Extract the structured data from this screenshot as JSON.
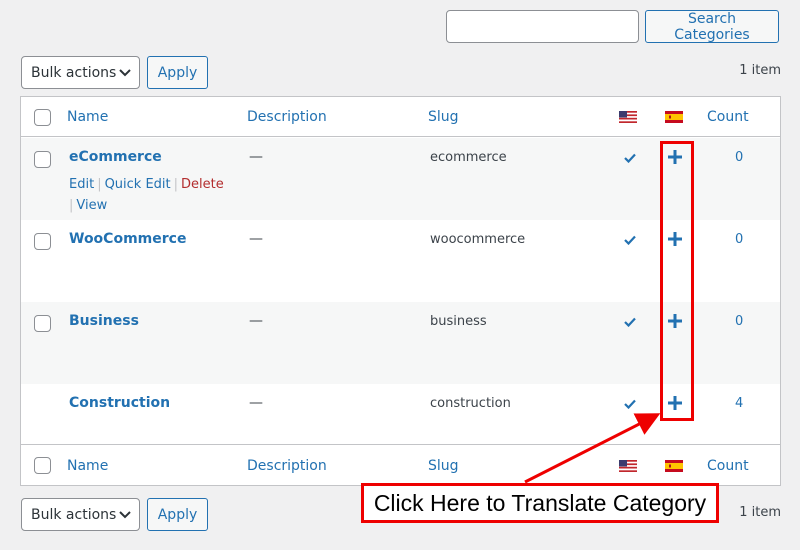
{
  "search": {
    "input_value": "",
    "button_label": "Search Categories"
  },
  "tablenav_top": {
    "bulk_actions_label": "Bulk actions",
    "apply_label": "Apply",
    "items_count": "1 item"
  },
  "tablenav_bottom": {
    "bulk_actions_label": "Bulk actions",
    "apply_label": "Apply",
    "items_count": "1 item"
  },
  "table": {
    "columns": {
      "name": "Name",
      "description": "Description",
      "slug": "Slug",
      "flag_en": "us-flag-icon",
      "flag_es": "spain-flag-icon",
      "count": "Count"
    },
    "rows": [
      {
        "name": "eCommerce",
        "description": "—",
        "slug": "ecommerce",
        "count": "0",
        "actions": {
          "edit": "Edit",
          "quick_edit": "Quick Edit",
          "delete": "Delete",
          "view": "View"
        }
      },
      {
        "name": "WooCommerce",
        "description": "—",
        "slug": "woocommerce",
        "count": "0"
      },
      {
        "name": "Business",
        "description": "—",
        "slug": "business",
        "count": "0"
      },
      {
        "name": "Construction",
        "description": "—",
        "slug": "construction",
        "count": "4"
      }
    ]
  },
  "annotation": {
    "text": "Click Here to Translate Category",
    "color": "#ee0000"
  },
  "colors": {
    "link": "#2271b1",
    "delete": "#b32d2e",
    "background": "#f0f0f1"
  }
}
